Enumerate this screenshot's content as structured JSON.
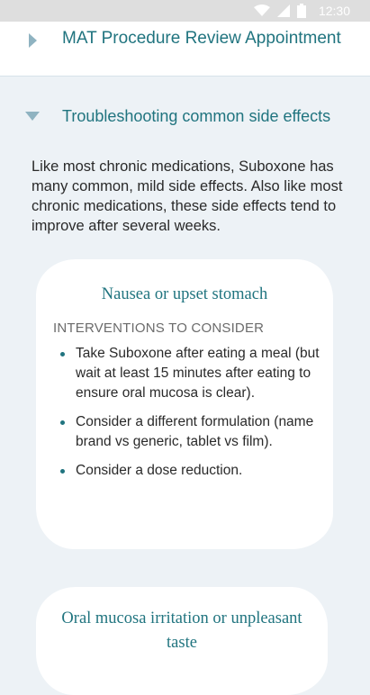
{
  "status_bar": {
    "time": "12:30",
    "icons": [
      "wifi-icon",
      "signal-icon",
      "battery-icon"
    ]
  },
  "collapsed_section": {
    "title": "MAT Procedure Review Appointment",
    "icon": "chevron-right-icon"
  },
  "expanded_section": {
    "title": "Troubleshooting common side effects",
    "icon": "chevron-down-icon",
    "intro": "Like most chronic medications, Suboxone has many common, mild side effects. Also like most chronic medications, these side effects tend to improve after several weeks."
  },
  "cards": [
    {
      "title": "Nausea or upset stomach",
      "label": "INTERVENTIONS TO CONSIDER",
      "items": [
        "Take Suboxone after eating a meal (but wait at least 15 minutes after eating to ensure oral mucosa is clear).",
        "Consider a different formulation (name brand vs generic, tablet vs film).",
        "Consider a dose reduction."
      ]
    },
    {
      "title": "Oral mucosa irritation or unpleasant taste"
    }
  ],
  "colors": {
    "accent": "#20747f",
    "arrow": "#8fb3c1",
    "background": "#edf2f6",
    "status_bar": "#dedede"
  }
}
